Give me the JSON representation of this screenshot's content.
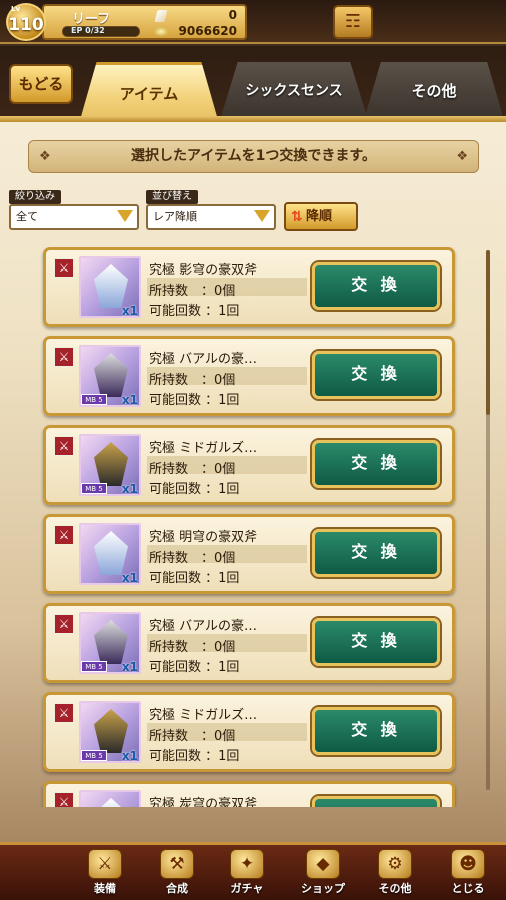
{
  "status": {
    "level_label": "Lv",
    "level": "110",
    "player_name": "リーフ",
    "ep_label": "EP",
    "ep_value": "0/32",
    "gems": "0",
    "coins": "9066620"
  },
  "header": {
    "back_label": "もどる",
    "tabs": [
      {
        "label": "アイテム",
        "active": true
      },
      {
        "label": "シックスセンス",
        "active": false
      },
      {
        "label": "その他",
        "active": false
      }
    ]
  },
  "banner": {
    "text": "選択したアイテムを1つ交換できます。"
  },
  "filters": {
    "filter_label": "絞り込み",
    "filter_value": "全て",
    "sort_label": "並び替え",
    "sort_value": "レア降順",
    "order_label": "降順"
  },
  "items": [
    {
      "name": "究極 影穹の豪双斧",
      "owned_label": "所持数",
      "owned": "：0個",
      "possible_label": "可能回数",
      "possible": "：1回",
      "qty": "x1",
      "mb": "",
      "exchange": "交 換"
    },
    {
      "name": "究極 バアルの豪…",
      "owned_label": "所持数",
      "owned": "：0個",
      "possible_label": "可能回数",
      "possible": "：1回",
      "qty": "x1",
      "mb": "MB 5",
      "exchange": "交 換"
    },
    {
      "name": "究極 ミドガルズ…",
      "owned_label": "所持数",
      "owned": "：0個",
      "possible_label": "可能回数",
      "possible": "：1回",
      "qty": "x1",
      "mb": "MB 5",
      "exchange": "交 換"
    },
    {
      "name": "究極 明穹の豪双斧",
      "owned_label": "所持数",
      "owned": "：0個",
      "possible_label": "可能回数",
      "possible": "：1回",
      "qty": "x1",
      "mb": "",
      "exchange": "交 換"
    },
    {
      "name": "究極 バアルの豪…",
      "owned_label": "所持数",
      "owned": "：0個",
      "possible_label": "可能回数",
      "possible": "：1回",
      "qty": "x1",
      "mb": "MB 5",
      "exchange": "交 換"
    },
    {
      "name": "究極 ミドガルズ…",
      "owned_label": "所持数",
      "owned": "：0個",
      "possible_label": "可能回数",
      "possible": "：1回",
      "qty": "x1",
      "mb": "MB 5",
      "exchange": "交 換"
    },
    {
      "name": "究極 炭穹の豪双斧",
      "owned_label": "",
      "owned": "",
      "possible_label": "",
      "possible": "",
      "qty": "",
      "mb": "",
      "exchange": ""
    }
  ],
  "bottom_nav": [
    {
      "label": "装備",
      "icon": "equipment-icon"
    },
    {
      "label": "合成",
      "icon": "hammer-icon"
    },
    {
      "label": "ガチャ",
      "icon": "gacha-icon"
    },
    {
      "label": "ショップ",
      "icon": "shop-crystal-icon"
    },
    {
      "label": "その他",
      "icon": "gears-icon"
    },
    {
      "label": "とじる",
      "icon": "close-character-icon"
    }
  ]
}
